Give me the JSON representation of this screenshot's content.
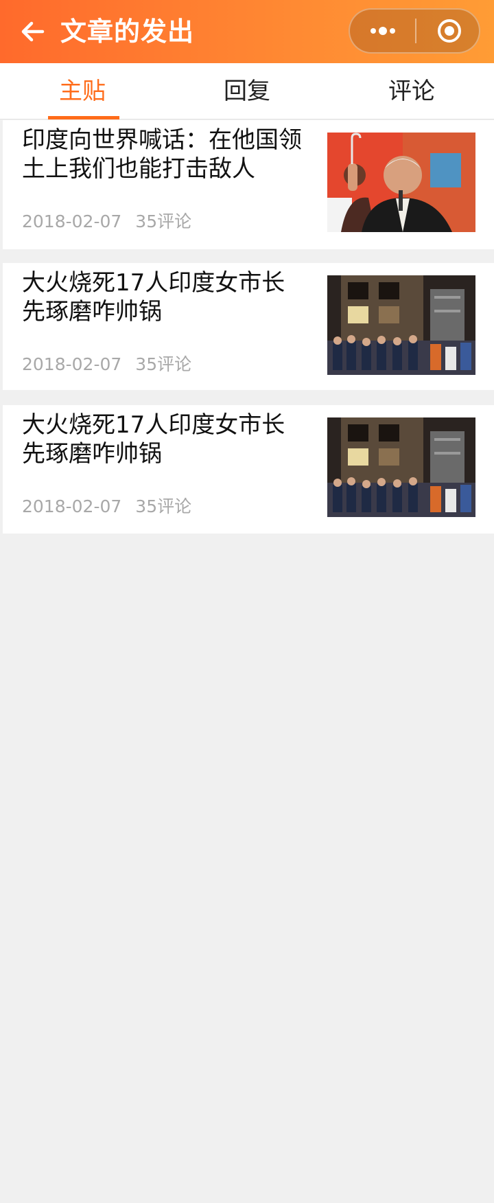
{
  "header": {
    "title": "文章的发出",
    "back_icon": "back-arrow-icon",
    "capsule_more_icon": "more-dots-icon",
    "capsule_close_icon": "target-circle-icon"
  },
  "tabs": [
    {
      "label": "主贴",
      "active": true
    },
    {
      "label": "回复",
      "active": false
    },
    {
      "label": "评论",
      "active": false
    }
  ],
  "posts": [
    {
      "title": "印度向世界喊话：在他国领土上我们也能打击敌人",
      "date": "2018-02-07",
      "comments": "35评论"
    },
    {
      "title": "大火烧死17人印度女市长先琢磨咋帅锅",
      "date": "2018-02-07",
      "comments": "35评论"
    },
    {
      "title": "大火烧死17人印度女市长先琢磨咋帅锅",
      "date": "2018-02-07",
      "comments": "35评论"
    }
  ],
  "colors": {
    "accent": "#ff6c1a",
    "header_start": "#ff6a2c",
    "header_end": "#ff9c35",
    "background": "#f0f0f0"
  }
}
